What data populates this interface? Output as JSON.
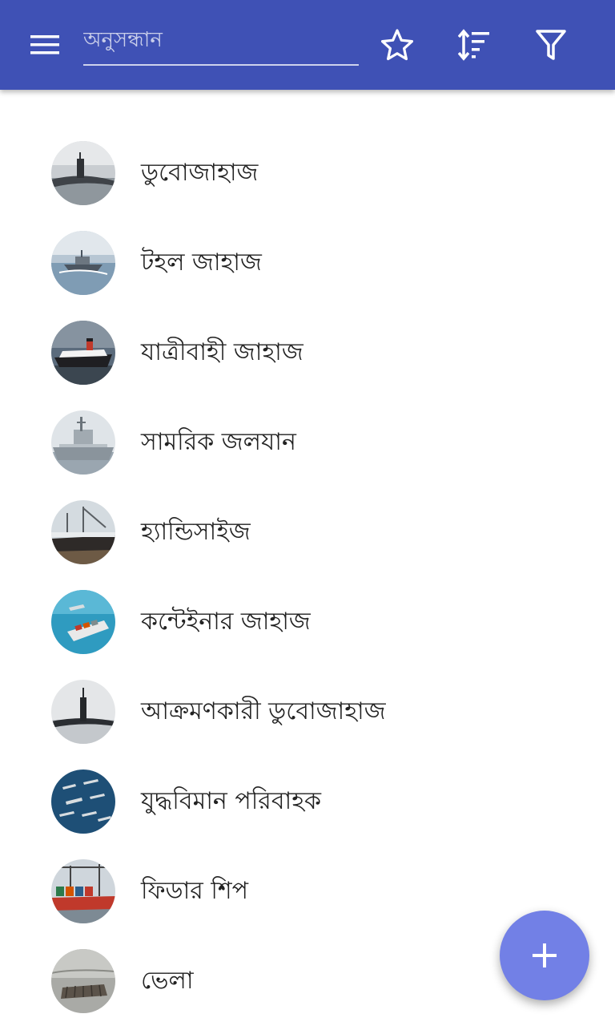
{
  "toolbar": {
    "search_placeholder": "অনুসন্ধান",
    "accent_color": "#3f51b5",
    "icons": [
      "menu-icon",
      "star-outline-icon",
      "sort-icon",
      "filter-icon"
    ]
  },
  "items": [
    {
      "label": "ডুবোজাহাজ",
      "thumbnail": "submarine"
    },
    {
      "label": "টহল জাহাজ",
      "thumbnail": "patrol-boat"
    },
    {
      "label": "যাত্রীবাহী জাহাজ",
      "thumbnail": "passenger-liner"
    },
    {
      "label": "সামরিক জলযান",
      "thumbnail": "warship"
    },
    {
      "label": "হ্যান্ডিসাইজ",
      "thumbnail": "cargo-ship-crane"
    },
    {
      "label": "কন্টেইনার জাহাজ",
      "thumbnail": "container-ship"
    },
    {
      "label": "আক্রমণকারী ডুবোজাহাজ",
      "thumbnail": "attack-submarine"
    },
    {
      "label": "যুদ্ধবিমান পরিবাহক",
      "thumbnail": "fleet-formation"
    },
    {
      "label": "ফিডার শিপ",
      "thumbnail": "feeder-ship-port"
    },
    {
      "label": "ভেলা",
      "thumbnail": "raft"
    }
  ],
  "fab": {
    "icon": "plus-icon",
    "color": "#7280e6"
  }
}
